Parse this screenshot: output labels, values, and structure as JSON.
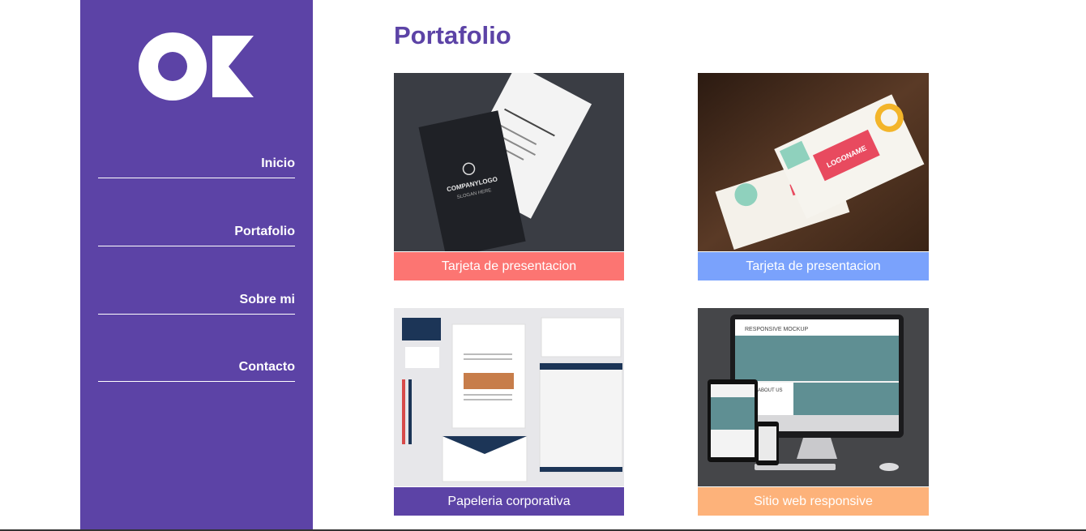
{
  "nav": {
    "items": [
      {
        "label": "Inicio"
      },
      {
        "label": "Portafolio"
      },
      {
        "label": "Sobre mi"
      },
      {
        "label": "Contacto"
      }
    ]
  },
  "main": {
    "title": "Portafolio",
    "cards": [
      {
        "caption": "Tarjeta de presentacion",
        "color": "#fc7572"
      },
      {
        "caption": "Tarjeta de presentacion",
        "color": "#7aa2fc"
      },
      {
        "caption": "Papeleria corporativa",
        "color": "#5c43a6"
      },
      {
        "caption": "Sitio web responsive",
        "color": "#fdb27a"
      }
    ],
    "mockup_text": {
      "card1_logo": "COMPANYLOGO",
      "card1_slogan": "SLOGAN HERE",
      "card2_logo": "LOGONAME",
      "card4_header": "RESPONSIVE MOCKUP",
      "card4_about": "ABOUT US"
    }
  },
  "colors": {
    "sidebar": "#5c43a6",
    "accent": "#5c43a6"
  }
}
